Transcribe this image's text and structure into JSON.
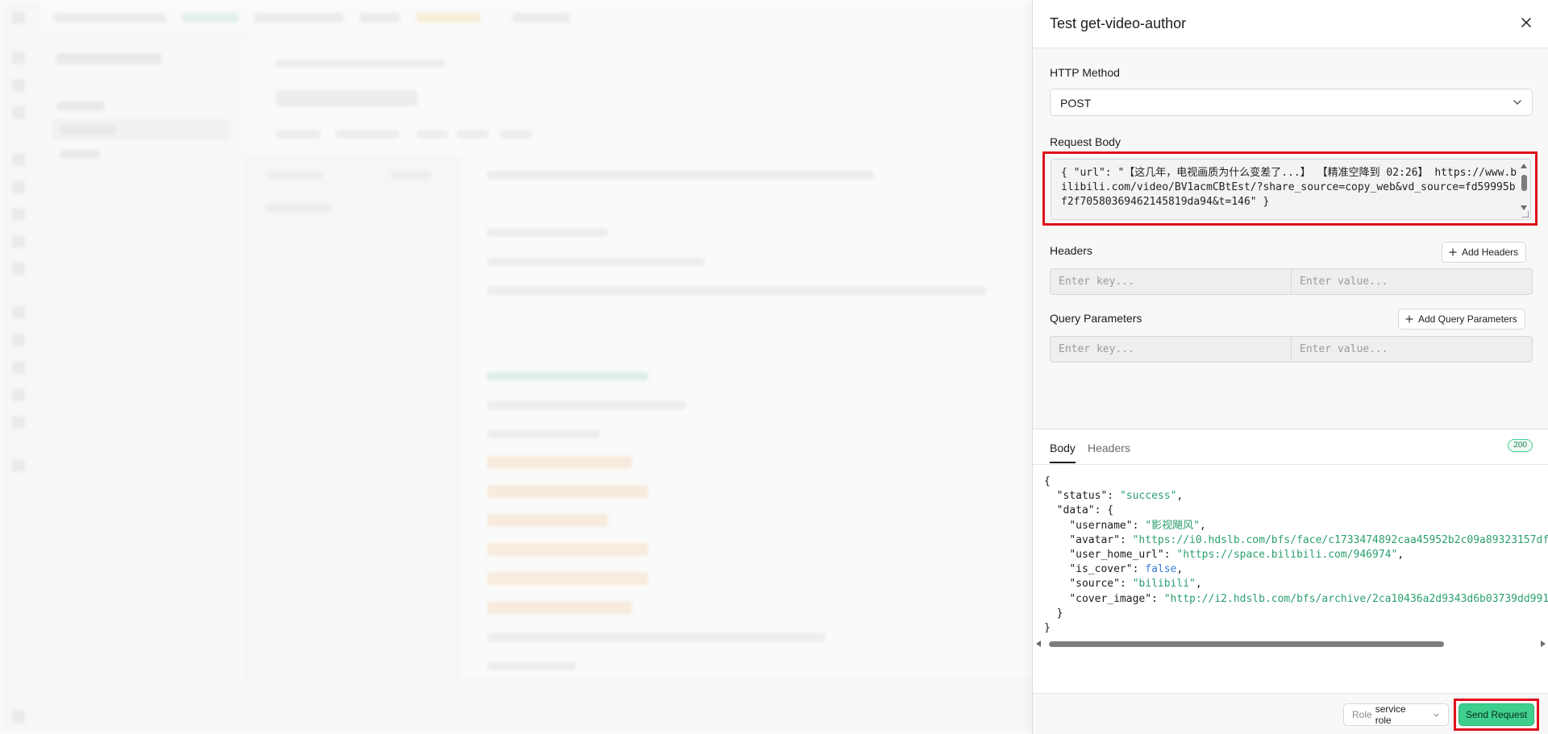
{
  "drawer": {
    "title": "Test get-video-author",
    "http_method_label": "HTTP Method",
    "http_method_value": "POST",
    "request_body_label": "Request Body",
    "request_body_text": "{ \"url\": \"【这几年，电视画质为什么变差了...】 【精准空降到 02:26】 https://www.bilibili.com/video/BV1acmCBtEst/?share_source=copy_web&vd_source=fd59995bf2f70580369462145819da94&t=146\" }",
    "headers_label": "Headers",
    "add_headers_label": "Add Headers",
    "query_params_label": "Query Parameters",
    "add_query_params_label": "Add Query Parameters",
    "key_placeholder": "Enter key...",
    "value_placeholder": "Enter value..."
  },
  "response": {
    "tabs": [
      {
        "label": "Body",
        "active": true
      },
      {
        "label": "Headers",
        "active": false
      }
    ],
    "status_code": "200",
    "json": {
      "status": "success",
      "username": "影视飓风",
      "avatar": "https://i0.hdslb.com/bfs/face/c1733474892caa45952b2c09a89323157df",
      "user_home_url": "https://space.bilibili.com/946974",
      "is_cover": "false",
      "source": "bilibili",
      "cover_image": "http://i2.hdslb.com/bfs/archive/2ca10436a2d9343d6b03739dd991"
    }
  },
  "footer": {
    "role_label": "Role",
    "role_value": "service role",
    "send_label": "Send Request"
  },
  "colors": {
    "accent": "#3ecf8e",
    "highlight": "#e0101a",
    "json_string": "#2ba06e",
    "json_boolean": "#3b7dd8"
  }
}
